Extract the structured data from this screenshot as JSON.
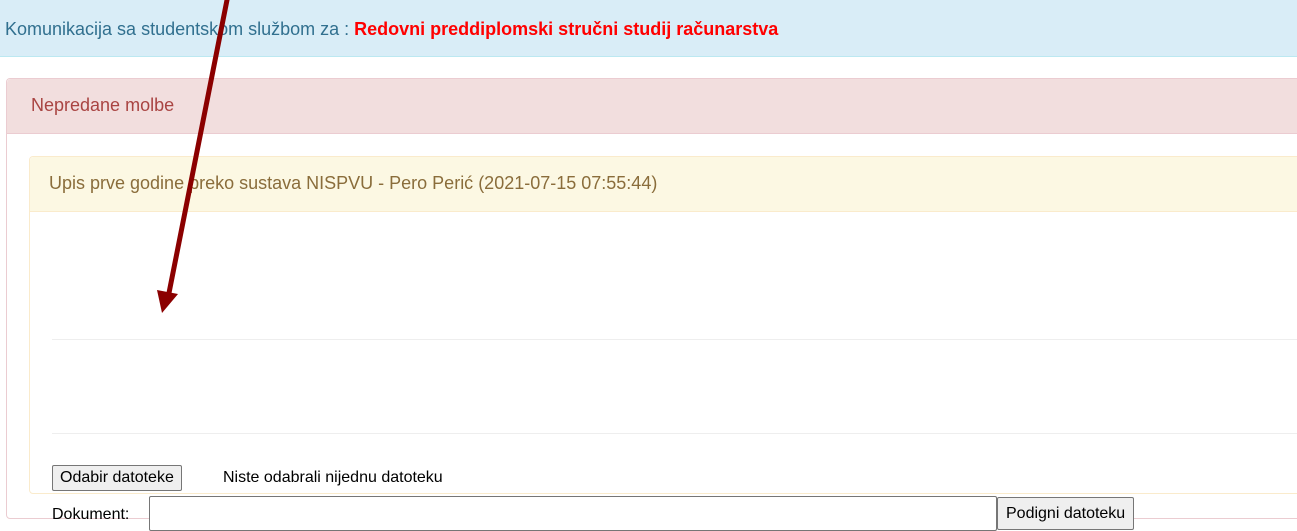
{
  "header": {
    "prefix": "Komunikacija sa studentskom službom za : ",
    "study_program": "Redovni preddiplomski stručni studij računarstva"
  },
  "outer_panel": {
    "title": "Nepredane molbe"
  },
  "request_panel": {
    "title": "Upis prve godine preko sustava NISPVU - Pero Perić (2021-07-15 07:55:44)"
  },
  "upload_form": {
    "choose_file_label": "Odabir datoteke",
    "no_file_text": "Niste odabrali nijednu datoteku",
    "document_label": "Dokument:",
    "document_value": "",
    "upload_button_label": "Podigni datoteku"
  },
  "colors": {
    "header_bg": "#d9edf7",
    "header_text": "#31708f",
    "highlight": "#ff0000",
    "danger_bg": "#f2dede",
    "danger_text": "#a94442",
    "warning_bg": "#fcf8e3",
    "warning_text": "#8a6d3b",
    "arrow": "#8b0000"
  },
  "annotation": {
    "icon": "arrow-annotation-icon"
  }
}
